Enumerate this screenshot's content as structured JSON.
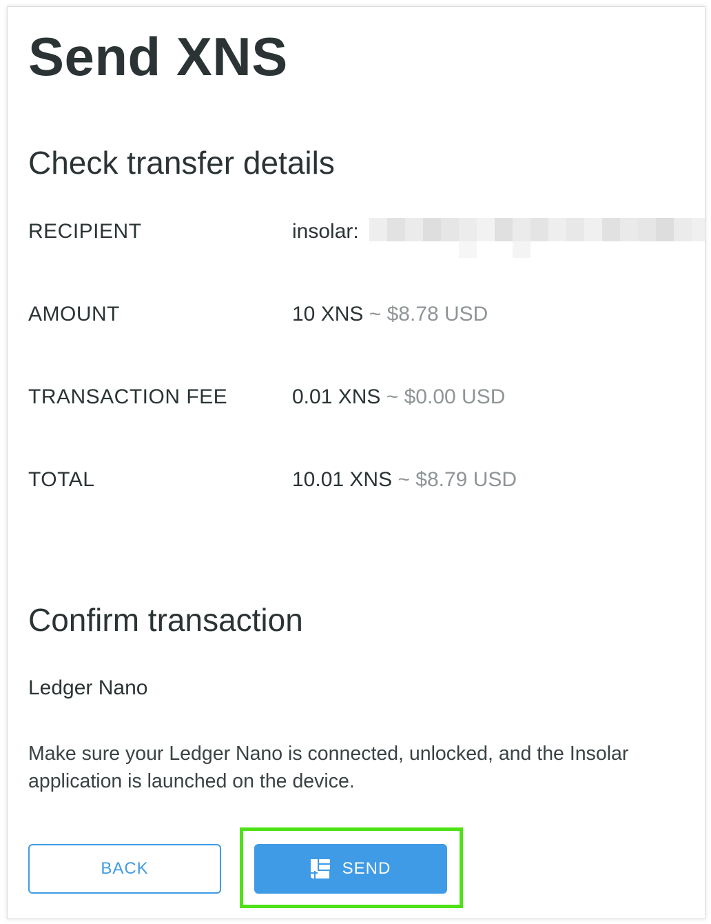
{
  "header": {
    "title": "Send XNS"
  },
  "details": {
    "heading": "Check transfer details",
    "recipient": {
      "label": "RECIPIENT",
      "value": "insolar:"
    },
    "amount": {
      "label": "AMOUNT",
      "value": "10 XNS",
      "usd": "~ $8.78 USD"
    },
    "fee": {
      "label": "TRANSACTION FEE",
      "value": "0.01 XNS",
      "usd": "~ $0.00 USD"
    },
    "total": {
      "label": "TOTAL",
      "value": "10.01 XNS",
      "usd": "~ $8.79 USD"
    }
  },
  "confirm": {
    "heading": "Confirm transaction",
    "device": "Ledger Nano",
    "instructions": "Make sure your Ledger Nano is connected, unlocked, and the Insolar application is launched on the device."
  },
  "actions": {
    "back_label": "BACK",
    "send_label": "SEND",
    "send_icon": "ledger-icon"
  },
  "colors": {
    "accent": "#3f9be5",
    "highlight": "#4ee216",
    "text": "#2b3335",
    "muted": "#8f9597"
  }
}
